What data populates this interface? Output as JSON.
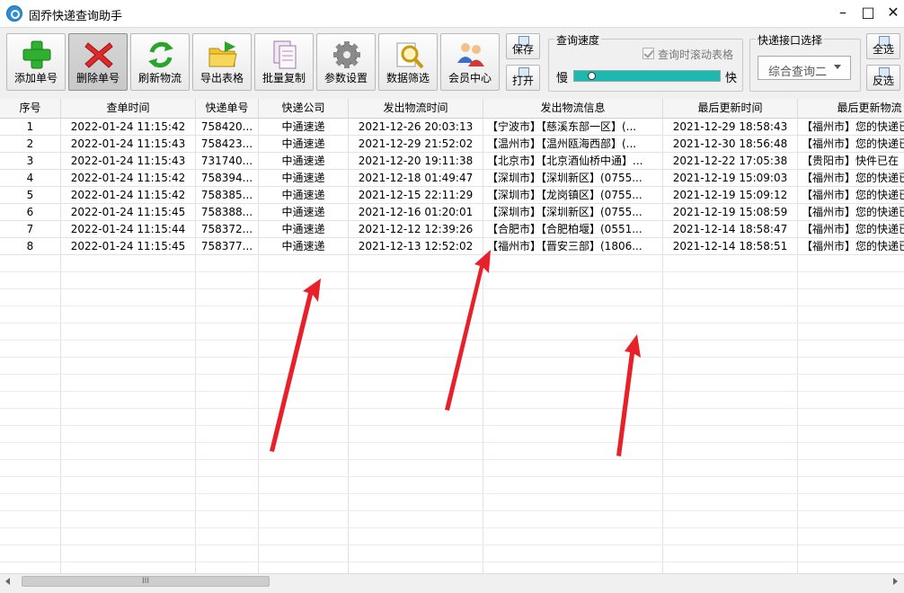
{
  "window": {
    "title": "固乔快递查询助手",
    "controls": {
      "minimize": "–",
      "maximize": "□",
      "close": "✕"
    }
  },
  "toolbar": {
    "buttons": [
      {
        "label": "添加单号",
        "icon": "plus-icon"
      },
      {
        "label": "删除单号",
        "icon": "delete-x-icon"
      },
      {
        "label": "刷新物流",
        "icon": "refresh-icon"
      },
      {
        "label": "导出表格",
        "icon": "export-folder-icon"
      },
      {
        "label": "批量复制",
        "icon": "copy-icon"
      },
      {
        "label": "参数设置",
        "icon": "gear-icon"
      },
      {
        "label": "数据筛选",
        "icon": "magnifier-icon"
      },
      {
        "label": "会员中心",
        "icon": "users-icon"
      }
    ],
    "save_label": "保存",
    "open_label": "打开",
    "speed": {
      "group_label": "查询速度",
      "scroll_checkbox_label": "查询时滚动表格",
      "slow_label": "慢",
      "fast_label": "快",
      "level": 0.05
    },
    "api": {
      "group_label": "快递接口选择",
      "selected": "综合查询二"
    },
    "select_all_label": "全选",
    "invert_label": "反选"
  },
  "table": {
    "columns": [
      "序号",
      "查单时间",
      "快递单号",
      "快递公司",
      "发出物流时间",
      "发出物流信息",
      "最后更新时间",
      "最后更新物流"
    ],
    "rows": [
      [
        "1",
        "2022-01-24 11:15:42",
        "758420...",
        "中通速递",
        "2021-12-26 20:03:13",
        "【宁波市】【慈溪东部一区】(...",
        "2021-12-29 18:58:43",
        "【福州市】您的快递已"
      ],
      [
        "2",
        "2022-01-24 11:15:43",
        "758423...",
        "中通速递",
        "2021-12-29 21:52:02",
        "【温州市】【温州瓯海西部】(...",
        "2021-12-30 18:56:48",
        "【福州市】您的快递已"
      ],
      [
        "3",
        "2022-01-24 11:15:43",
        "731740...",
        "中通速递",
        "2021-12-20 19:11:38",
        "【北京市】【北京酒仙桥中通】...",
        "2021-12-22 17:05:38",
        "【贵阳市】快件已在"
      ],
      [
        "4",
        "2022-01-24 11:15:42",
        "758394...",
        "中通速递",
        "2021-12-18 01:49:47",
        "【深圳市】【深圳新区】(0755...",
        "2021-12-19 15:09:03",
        "【福州市】您的快递已"
      ],
      [
        "5",
        "2022-01-24 11:15:42",
        "758385...",
        "中通速递",
        "2021-12-15 22:11:29",
        "【深圳市】【龙岗镇区】(0755...",
        "2021-12-19 15:09:12",
        "【福州市】您的快递已"
      ],
      [
        "6",
        "2022-01-24 11:15:45",
        "758388...",
        "中通速递",
        "2021-12-16 01:20:01",
        "【深圳市】【深圳新区】(0755...",
        "2021-12-19 15:08:59",
        "【福州市】您的快递已"
      ],
      [
        "7",
        "2022-01-24 11:15:44",
        "758372...",
        "中通速递",
        "2021-12-12 12:39:26",
        "【合肥市】【合肥柏堰】(0551...",
        "2021-12-14 18:58:47",
        "【福州市】您的快递已"
      ],
      [
        "8",
        "2022-01-24 11:15:45",
        "758377...",
        "中通速递",
        "2021-12-13 12:52:02",
        "【福州市】【晋安三部】(1806...",
        "2021-12-14 18:58:51",
        "【福州市】您的快递已"
      ]
    ]
  },
  "scrollbar": {
    "grip": "III"
  },
  "colors": {
    "accent": "#2cd0c5",
    "arrow": "#e8202a",
    "titlebar": "#ffffff"
  }
}
